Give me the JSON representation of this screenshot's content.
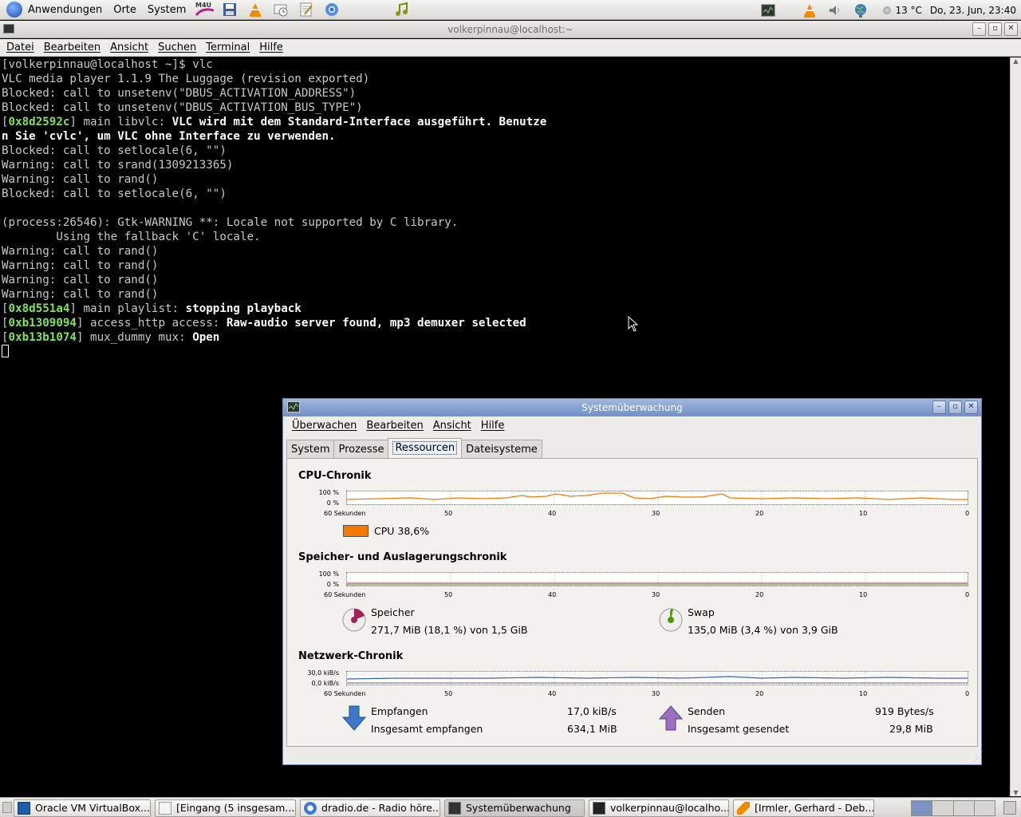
{
  "top_panel": {
    "menus": [
      "Anwendungen",
      "Orte",
      "System"
    ],
    "weather": "13 °C",
    "clock": "Do, 23. Jun, 23:40"
  },
  "terminal": {
    "title": "volkerpinnau@localhost:~",
    "menu": [
      "Datei",
      "Bearbeiten",
      "Ansicht",
      "Suchen",
      "Terminal",
      "Hilfe"
    ],
    "lines": [
      "[volkerpinnau@localhost ~]$ vlc",
      "VLC media player 1.1.9 The Luggage (revision exported)",
      "Blocked: call to unsetenv(\"DBUS_ACTIVATION_ADDRESS\")",
      "Blocked: call to unsetenv(\"DBUS_ACTIVATION_BUS_TYPE\")",
      "",
      "",
      "Blocked: call to setlocale(6, \"\")",
      "Warning: call to srand(1309213365)",
      "Warning: call to rand()",
      "Blocked: call to setlocale(6, \"\")",
      "",
      "(process:26546): Gtk-WARNING **: Locale not supported by C library.",
      "        Using the fallback 'C' locale.",
      "Warning: call to rand()",
      "Warning: call to rand()",
      "Warning: call to rand()",
      "Warning: call to rand()"
    ],
    "line_vlc_addr": "0x8d2592c",
    "line_vlc_mod": " main libvlc: ",
    "line_vlc_msg1": "VLC wird mit dem Standard-Interface ausgeführt. Benutze",
    "line_vlc_msg2": "n Sie 'cvlc', um VLC ohne Interface zu verwenden.",
    "log_playlist_addr": "0x8d551a4",
    "log_playlist_mod": " main playlist: ",
    "log_playlist_msg": "stopping playback",
    "log_access_addr": "0xb1309094",
    "log_access_mod": " access_http access: ",
    "log_access_msg": "Raw-audio server found, mp3 demuxer selected",
    "log_mux_addr": "0xb13b1074",
    "log_mux_mod": " mux_dummy mux: ",
    "log_mux_msg": "Open"
  },
  "sysmon": {
    "title": "Systemüberwachung",
    "menu": [
      "Überwachen",
      "Bearbeiten",
      "Ansicht",
      "Hilfe"
    ],
    "tabs": [
      "System",
      "Prozesse",
      "Ressourcen",
      "Dateisysteme"
    ],
    "active_tab": "Ressourcen",
    "x_ticks": [
      "60 Sekunden",
      "50",
      "40",
      "30",
      "20",
      "10",
      "0"
    ],
    "cpu": {
      "title": "CPU-Chronik",
      "y_ticks": [
        "100 %",
        "0 %"
      ],
      "label": "CPU 38,6%",
      "color": "#f57900"
    },
    "mem": {
      "title": "Speicher- und Auslagerungschronik",
      "y_ticks": [
        "100 %",
        "0 %"
      ],
      "mem_label": "Speicher",
      "mem_value": "271,7 MiB (18,1 %) von 1,5 GiB",
      "mem_color": "#a4215a",
      "swap_label": "Swap",
      "swap_value": "135,0 MiB (3,4 %) von 3,9 GiB",
      "swap_color": "#4e9a06"
    },
    "net": {
      "title": "Netzwerk-Chronik",
      "y_ticks": [
        "30,0 kiB/s",
        "0,0 kiB/s"
      ],
      "recv_label": "Empfangen",
      "recv_rate": "17,0 kiB/s",
      "recv_total_label": "Insgesamt empfangen",
      "recv_total": "634,1 MiB",
      "send_label": "Senden",
      "send_rate": "919 Bytes/s",
      "send_total_label": "Insgesamt gesendet",
      "send_total": "29,8 MiB",
      "recv_color": "#3465a4",
      "send_color": "#75507b"
    }
  },
  "taskbar": [
    {
      "label": "Oracle VM VirtualBox...",
      "icon": "virtualbox-icon"
    },
    {
      "label": "[Eingang (5 insgesam...",
      "icon": "mail-icon"
    },
    {
      "label": "dradio.de - Radio höre...",
      "icon": "chrome-icon"
    },
    {
      "label": "Systemüberwachung",
      "icon": "system-monitor-icon",
      "active": true
    },
    {
      "label": "volkerpinnau@localho...",
      "icon": "terminal-icon"
    },
    {
      "label": "[Irmler, Gerhard - Deb...",
      "icon": "vlc-icon"
    }
  ]
}
